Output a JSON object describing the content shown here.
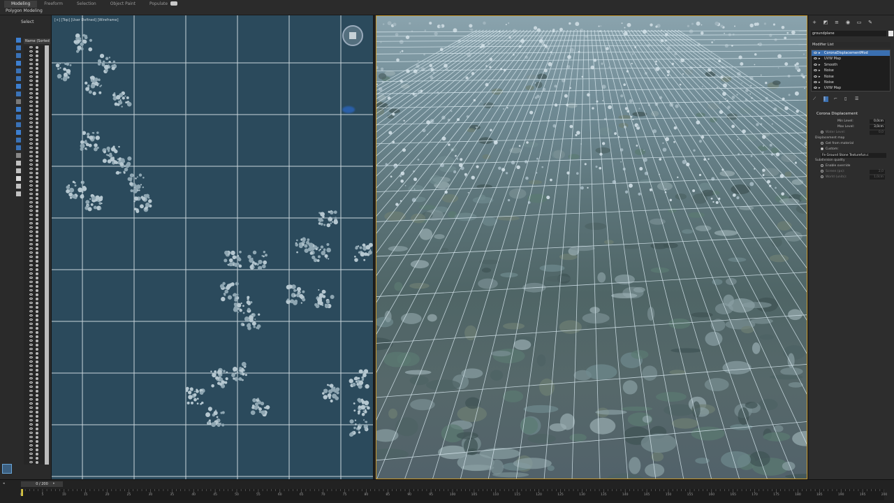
{
  "ribbon": {
    "tabs": [
      {
        "label": "Modeling",
        "active": true
      },
      {
        "label": "Freeform",
        "active": false
      },
      {
        "label": "Selection",
        "active": false
      },
      {
        "label": "Object Paint",
        "active": false
      },
      {
        "label": "Populate",
        "active": false
      }
    ],
    "subtitle": "Polygon Modeling"
  },
  "explorer": {
    "select_label": "Select",
    "column_header": "Name (Sorted A",
    "time_field": "0 / 200"
  },
  "top_viewport": {
    "label": "[+] [Top] [User Defined] [Wireframe]"
  },
  "command_panel": {
    "object_name": "groundplane",
    "modifier_list_label": "Modifier List",
    "stack": [
      {
        "label": "CoronaDisplacementMod",
        "selected": true
      },
      {
        "label": "UVW Map",
        "selected": false
      },
      {
        "label": "Smooth",
        "selected": false
      },
      {
        "label": "Noise",
        "selected": false
      },
      {
        "label": "Noise",
        "selected": false
      },
      {
        "label": "Noise",
        "selected": false
      },
      {
        "label": "UVW Map",
        "selected": false
      }
    ],
    "rollout": {
      "title": "Corona Displacement",
      "min_level_label": "Min Level:",
      "min_level_value": "0,0cm",
      "max_level_label": "Max Level:",
      "max_level_value": "3,0cm",
      "water_level_label": "Water Level:",
      "water_level_value": "0,0",
      "displacement_map_label": "Displacement map",
      "get_from_material_label": "Get from material",
      "custom_label": "Custom:",
      "map_name": "Fe Ground Stone Texturefun.c",
      "subdivision_label": "Subdivision quality",
      "enable_override_label": "Enable override",
      "screen_label": "Screen (px):",
      "screen_value": "2,0",
      "world_label": "World (units):",
      "world_value": "1,0cm"
    }
  },
  "timeline": {
    "ticks": [
      "0",
      "5",
      "10",
      "15",
      "20",
      "25",
      "30",
      "35",
      "40",
      "45",
      "50",
      "55",
      "60",
      "65",
      "70",
      "75",
      "80",
      "85",
      "90",
      "95",
      "100",
      "105",
      "110",
      "115",
      "120",
      "125",
      "130",
      "135",
      "140",
      "145",
      "150",
      "155",
      "160",
      "165",
      "170",
      "175",
      "180",
      "185",
      "190",
      "195",
      "200"
    ],
    "current_frame": "0"
  },
  "colors": {
    "viewport_bg": "#2b4a5c",
    "active_border": "#c89a2e",
    "selection_blue": "#3a6fb0"
  }
}
